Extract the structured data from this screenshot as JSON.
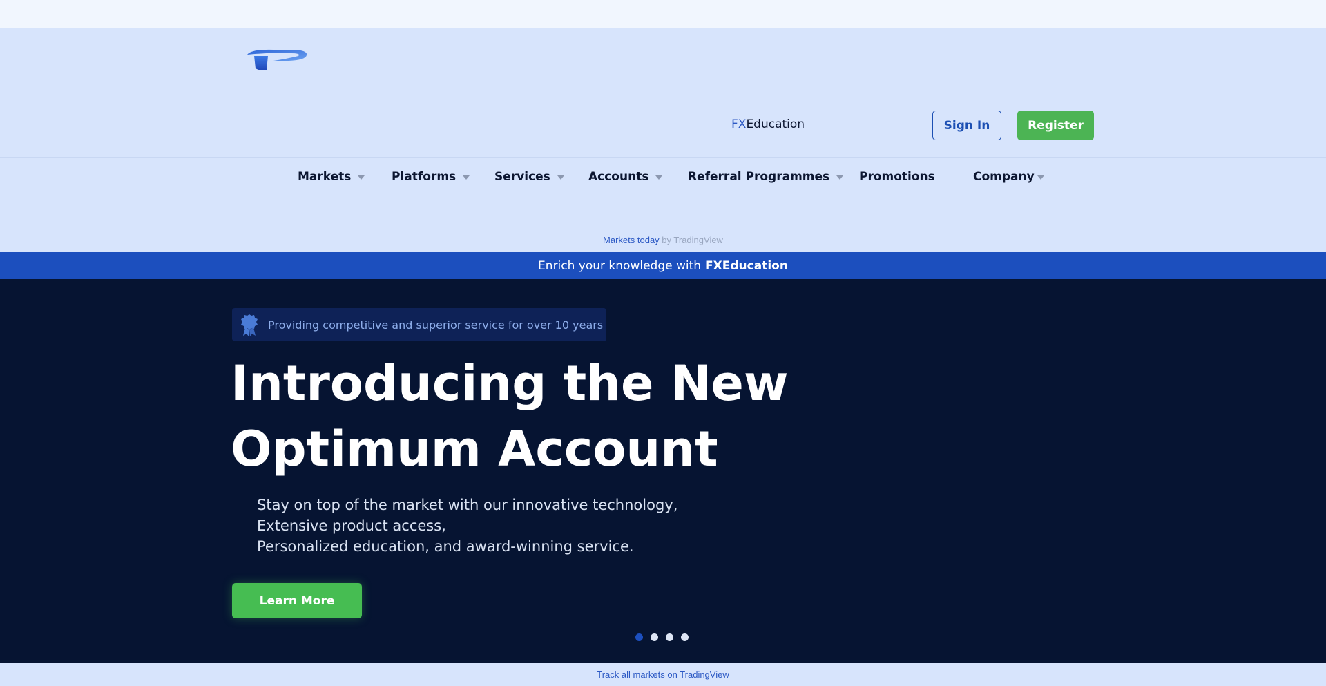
{
  "header": {
    "logo_icon": "brand-logo-icon",
    "fxeducation_link": {
      "prefix": "FX",
      "suffix": "Education"
    },
    "sign_in_label": "Sign In",
    "register_label": "Register"
  },
  "nav": {
    "items": [
      {
        "label": "Markets",
        "has_dropdown": true
      },
      {
        "label": "Platforms",
        "has_dropdown": true
      },
      {
        "label": "Services",
        "has_dropdown": true
      },
      {
        "label": "Accounts",
        "has_dropdown": true
      },
      {
        "label": "Referral Programmes",
        "has_dropdown": true
      },
      {
        "label": "Promotions",
        "has_dropdown": false
      },
      {
        "label": "Company",
        "has_dropdown": true
      }
    ]
  },
  "ticker": {
    "link_text": "Markets today",
    "by_text": " by TradingView"
  },
  "banner": {
    "text": "Enrich your knowledge with",
    "bold": "FXEducation"
  },
  "hero": {
    "badge_icon": "award-ribbon-icon",
    "badge_text": "Providing competitive and superior service for over 10 years",
    "title_line1": "Introducing the New",
    "title_line2": "Optimum Account",
    "desc_lines": [
      "Stay on top of the market with our innovative technology,",
      "Extensive product access,",
      "Personalized education, and award-winning service."
    ],
    "cta_label": "Learn More",
    "slides_total": 4,
    "slide_active": 1
  },
  "footer_bar": {
    "text": "Track all markets on TradingView"
  },
  "colors": {
    "header_bg": "#d7e4fc",
    "hero_bg": "#061432",
    "banner_bg": "#1c4fbe",
    "accent_green": "#4cb454",
    "accent_blue": "#1c4fb3"
  }
}
